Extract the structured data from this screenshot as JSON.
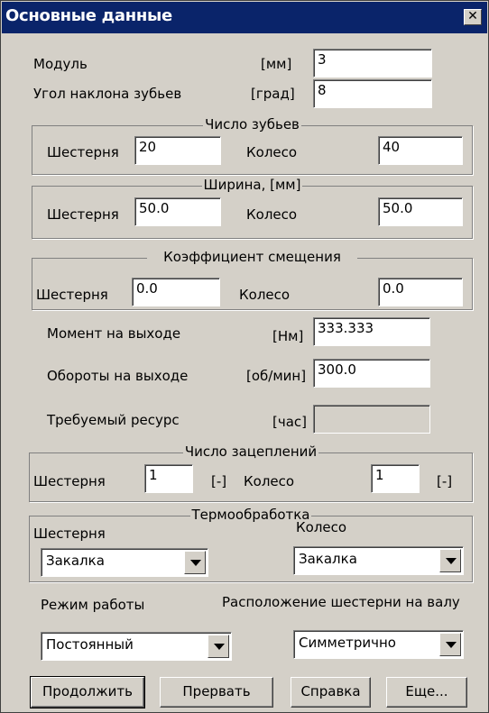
{
  "window": {
    "title": "Основные данные",
    "close_glyph": "✕"
  },
  "module": {
    "label": "Модуль",
    "unit": "[мм]",
    "value": "3"
  },
  "helix_angle": {
    "label": "Угол наклона зубьев",
    "unit": "[град]",
    "value": "8"
  },
  "teeth": {
    "title": "Число зубьев",
    "pinion_label": "Шестерня",
    "pinion_value": "20",
    "wheel_label": "Колесо",
    "wheel_value": "40"
  },
  "width": {
    "title": "Ширина, [мм]",
    "pinion_label": "Шестерня",
    "pinion_value": "50.0",
    "wheel_label": "Колесо",
    "wheel_value": "50.0"
  },
  "shift": {
    "title": "Коэффициент смещения",
    "pinion_label": "Шестерня",
    "pinion_value": "0.0",
    "wheel_label": "Колесо",
    "wheel_value": "0.0"
  },
  "torque": {
    "label": "Момент на выходе",
    "unit": "[Нм]",
    "value": "333.333"
  },
  "speed": {
    "label": "Обороты на выходе",
    "unit": "[об/мин]",
    "value": "300.0"
  },
  "resource": {
    "label": "Требуемый ресурс",
    "unit": "[час]",
    "value": ""
  },
  "meshes": {
    "title": "Число зацеплений",
    "pinion_label": "Шестерня",
    "pinion_value": "1",
    "pinion_unit": "[-]",
    "wheel_label": "Колесо",
    "wheel_value": "1",
    "wheel_unit": "[-]"
  },
  "heat": {
    "title": "Термообработка",
    "pinion_label": "Шестерня",
    "pinion_value": "Закалка",
    "wheel_label": "Колесо",
    "wheel_value": "Закалка"
  },
  "mode": {
    "label": "Режим работы",
    "value": "Постоянный"
  },
  "position": {
    "label": "Расположение шестерни на валу",
    "value": "Симметрично"
  },
  "buttons": {
    "continue": "Продолжить",
    "abort": "Прервать",
    "help": "Справка",
    "more": "Еще..."
  },
  "colors": {
    "titlebar": "#0a246a",
    "face": "#d4d0c8"
  }
}
